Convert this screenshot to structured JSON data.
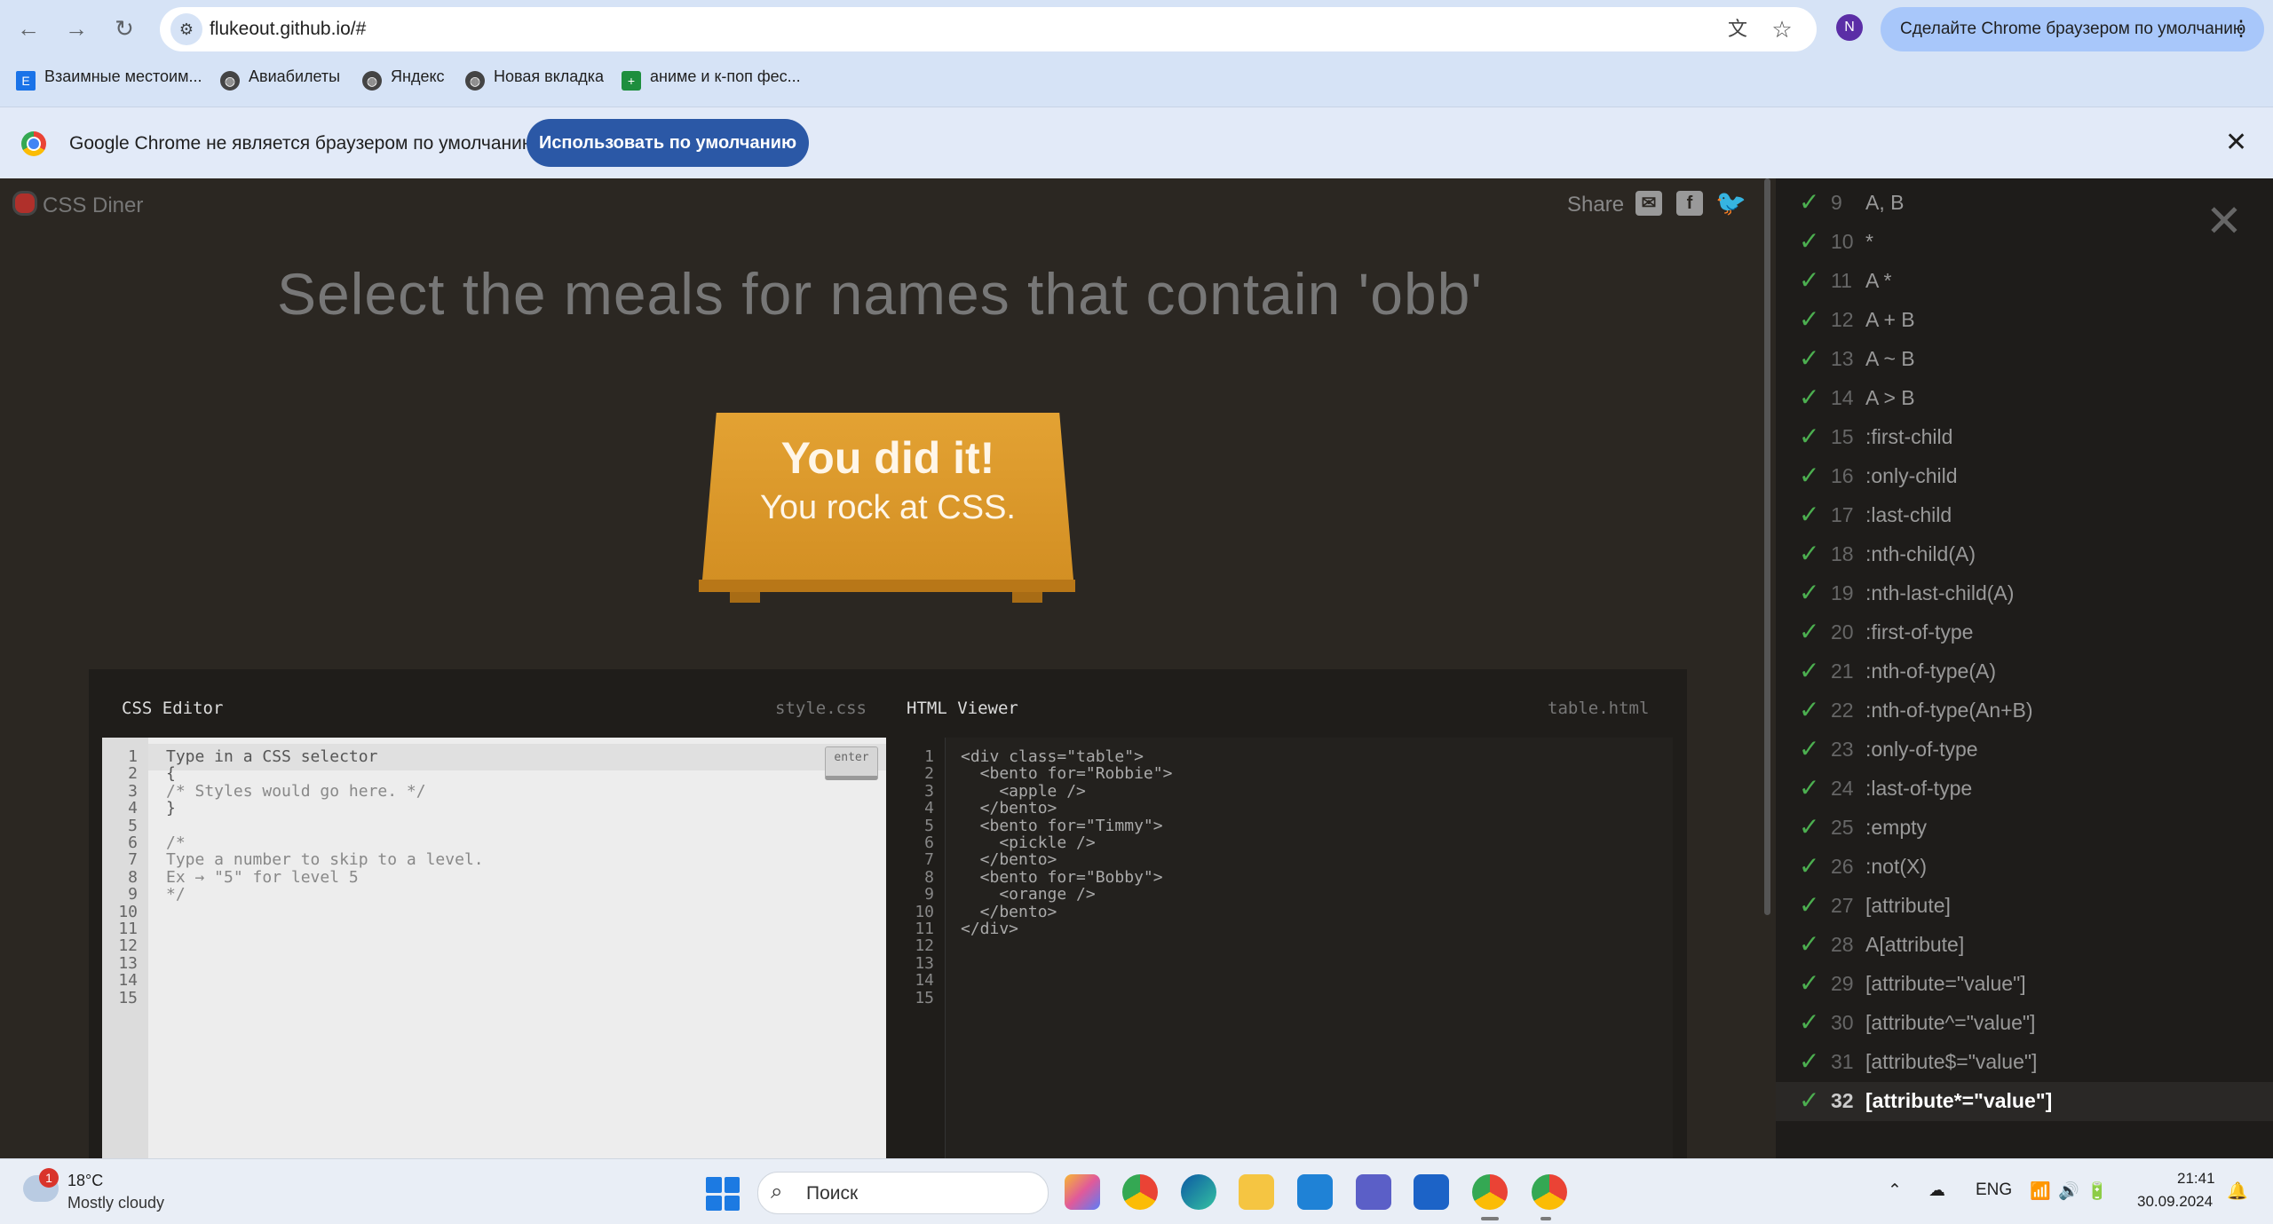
{
  "browser": {
    "url": "flukeout.github.io/#",
    "profile_initial": "N",
    "default_chip": "Сделайте Chrome браузером по умолчанию",
    "bookmarks": [
      {
        "label": "Взаимные местоим...",
        "icon": "dictionary-icon"
      },
      {
        "label": "Авиабилеты",
        "icon": "globe-icon"
      },
      {
        "label": "Яндекс",
        "icon": "globe-icon"
      },
      {
        "label": "Новая вкладка",
        "icon": "globe-icon"
      },
      {
        "label": "аниме и к-поп фес...",
        "icon": "sheets-icon"
      }
    ]
  },
  "infobar": {
    "text": "Google Chrome не является браузером по умолчанию.",
    "button": "Использовать по умолчанию",
    "close": "✕"
  },
  "game": {
    "logo": "CSS Diner",
    "share_label": "Share",
    "order": "Select the meals for names that contain 'obb'",
    "win_title": "You did it!",
    "win_subtitle": "You rock at CSS."
  },
  "editor": {
    "css_title": "CSS Editor",
    "css_file": "style.css",
    "html_title": "HTML Viewer",
    "html_file": "table.html",
    "input_placeholder": "Type in a CSS selector",
    "enter_label": "enter",
    "css_lines": [
      "",
      "{",
      "/* Styles would go here. */",
      "}",
      "",
      "/*",
      "Type a number to skip to a level.",
      "Ex → \"5\" for level 5",
      "*/",
      "",
      "",
      "",
      "",
      "",
      ""
    ],
    "html_lines": [
      "<div class=\"table\">",
      "  <bento for=\"Robbie\">",
      "    <apple />",
      "  </bento>",
      "  <bento for=\"Timmy\">",
      "    <pickle />",
      "  </bento>",
      "  <bento for=\"Bobby\">",
      "    <orange />",
      "  </bento>",
      "</div>",
      "",
      "",
      "",
      ""
    ],
    "line_numbers": [
      "1",
      "2",
      "3",
      "4",
      "5",
      "6",
      "7",
      "8",
      "9",
      "10",
      "11",
      "12",
      "13",
      "14",
      "15"
    ]
  },
  "levels": {
    "check": "✓",
    "current": "32",
    "items": [
      {
        "num": "9",
        "name": "A, B"
      },
      {
        "num": "10",
        "name": "*"
      },
      {
        "num": "11",
        "name": "A *"
      },
      {
        "num": "12",
        "name": "A + B"
      },
      {
        "num": "13",
        "name": "A ~ B"
      },
      {
        "num": "14",
        "name": "A > B"
      },
      {
        "num": "15",
        "name": ":first-child"
      },
      {
        "num": "16",
        "name": ":only-child"
      },
      {
        "num": "17",
        "name": ":last-child"
      },
      {
        "num": "18",
        "name": ":nth-child(A)"
      },
      {
        "num": "19",
        "name": ":nth-last-child(A)"
      },
      {
        "num": "20",
        "name": ":first-of-type"
      },
      {
        "num": "21",
        "name": ":nth-of-type(A)"
      },
      {
        "num": "22",
        "name": ":nth-of-type(An+B)"
      },
      {
        "num": "23",
        "name": ":only-of-type"
      },
      {
        "num": "24",
        "name": ":last-of-type"
      },
      {
        "num": "25",
        "name": ":empty"
      },
      {
        "num": "26",
        "name": ":not(X)"
      },
      {
        "num": "27",
        "name": "[attribute]"
      },
      {
        "num": "28",
        "name": "A[attribute]"
      },
      {
        "num": "29",
        "name": "[attribute=\"value\"]"
      },
      {
        "num": "30",
        "name": "[attribute^=\"value\"]"
      },
      {
        "num": "31",
        "name": "[attribute$=\"value\"]"
      },
      {
        "num": "32",
        "name": "[attribute*=\"value\"]"
      }
    ]
  },
  "taskbar": {
    "weather_badge": "1",
    "weather_temp": "18°C",
    "weather_desc": "Mostly cloudy",
    "search_label": "Поиск",
    "lang": "ENG",
    "time": "21:41",
    "date": "30.09.2024"
  }
}
